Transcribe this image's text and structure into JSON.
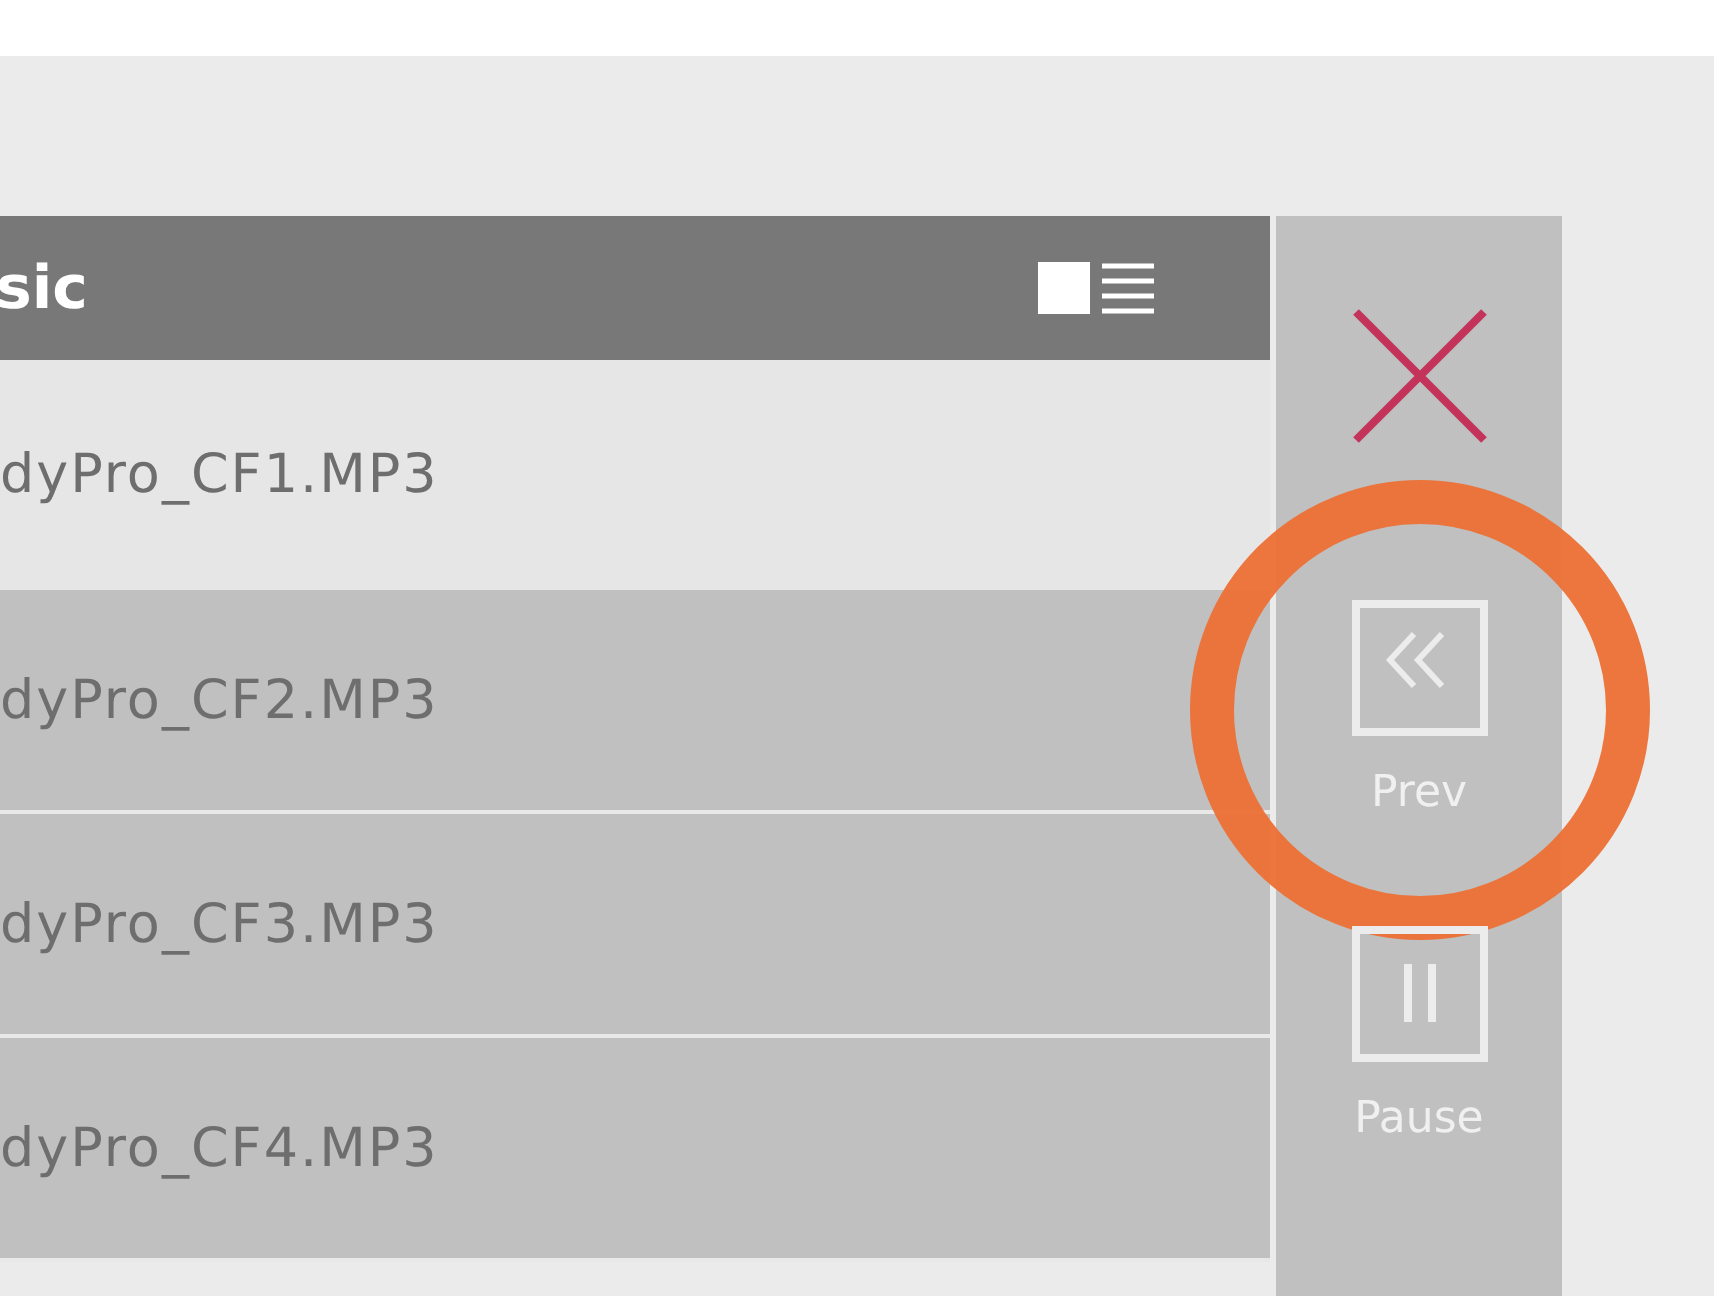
{
  "playlist": {
    "title": "sic",
    "tracks": [
      {
        "name": "dyPro_CF1.MP3",
        "selected": true
      },
      {
        "name": "dyPro_CF2.MP3",
        "selected": false
      },
      {
        "name": "dyPro_CF3.MP3",
        "selected": false
      },
      {
        "name": "dyPro_CF4.MP3",
        "selected": false
      }
    ]
  },
  "controls": [
    {
      "kind": "close"
    },
    {
      "kind": "prev",
      "label": "Prev",
      "highlighted": true
    },
    {
      "kind": "pause",
      "label": "Pause",
      "highlighted": false
    }
  ]
}
